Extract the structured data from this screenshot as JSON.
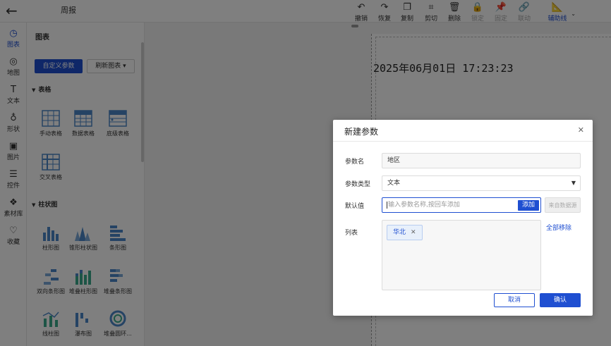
{
  "header": {
    "back_icon": "arrow-left-icon",
    "report_title": "周报"
  },
  "toolbar": [
    {
      "icon": "undo-icon",
      "glyph": "↶",
      "label": "撤销",
      "state": "normal"
    },
    {
      "icon": "redo-icon",
      "glyph": "↷",
      "label": "恢复",
      "state": "normal"
    },
    {
      "icon": "copy-icon",
      "glyph": "❐",
      "label": "复制",
      "state": "normal"
    },
    {
      "icon": "crop-icon",
      "glyph": "⌗",
      "label": "剪切",
      "state": "normal"
    },
    {
      "icon": "trash-icon",
      "glyph": "🗑",
      "label": "删除",
      "state": "normal"
    },
    {
      "icon": "lock-icon",
      "glyph": "🔒",
      "label": "锁定",
      "state": "disabled"
    },
    {
      "icon": "pin-icon",
      "glyph": "📌",
      "label": "固定",
      "state": "disabled"
    },
    {
      "icon": "link-icon",
      "glyph": "🔗",
      "label": "联动",
      "state": "disabled"
    },
    {
      "icon": "ruler-icon",
      "glyph": "📐",
      "label": "辅助线",
      "state": "primary"
    }
  ],
  "rail": [
    {
      "icon": "chart-icon",
      "glyph": "◷",
      "label": "图表",
      "active": true
    },
    {
      "icon": "map-icon",
      "glyph": "◎",
      "label": "地图",
      "active": false
    },
    {
      "icon": "text-icon",
      "glyph": "T",
      "label": "文本",
      "active": false
    },
    {
      "icon": "shape-icon",
      "glyph": "♁",
      "label": "形状",
      "active": false
    },
    {
      "icon": "image-icon",
      "glyph": "▣",
      "label": "图片",
      "active": false
    },
    {
      "icon": "control-icon",
      "glyph": "☰",
      "label": "控件",
      "active": false
    },
    {
      "icon": "material-icon",
      "glyph": "❖",
      "label": "素材库",
      "active": false
    },
    {
      "icon": "heart-icon",
      "glyph": "♡",
      "label": "收藏",
      "active": false
    }
  ],
  "panel": {
    "title": "图表",
    "custom_param_button": "自定义参数",
    "refresh_button": "刷新图表 ▾",
    "sections": [
      {
        "title": "表格",
        "items": [
          "手动表格",
          "数据表格",
          "底级表格",
          "交叉表格"
        ]
      },
      {
        "title": "柱状图",
        "items": [
          "柱形图",
          "锥形柱状图",
          "条形图",
          "双向条形图",
          "堆叠柱形图",
          "堆叠条形图",
          "线柱图",
          "瀑布图",
          "堆叠圆环..."
        ]
      }
    ]
  },
  "canvas": {
    "datetime_text": "2025年06月01日 17:23:23"
  },
  "dialog": {
    "title": "新建参数",
    "close_icon": "close-icon",
    "name_label": "参数名",
    "name_value": "地区",
    "type_label": "参数类型",
    "type_value": "文本",
    "default_label": "默认值",
    "default_placeholder": "输入参数名称,按回车添加",
    "add_button": "添加",
    "from_data_button": "来自数据源",
    "list_label": "列表",
    "list_items": [
      "华北"
    ],
    "remove_all_link": "全部移除",
    "cancel_button": "取消",
    "ok_button": "确认"
  },
  "colors": {
    "accent": "#1f4fd1",
    "overlay": "rgba(0,0,0,0.5)"
  }
}
